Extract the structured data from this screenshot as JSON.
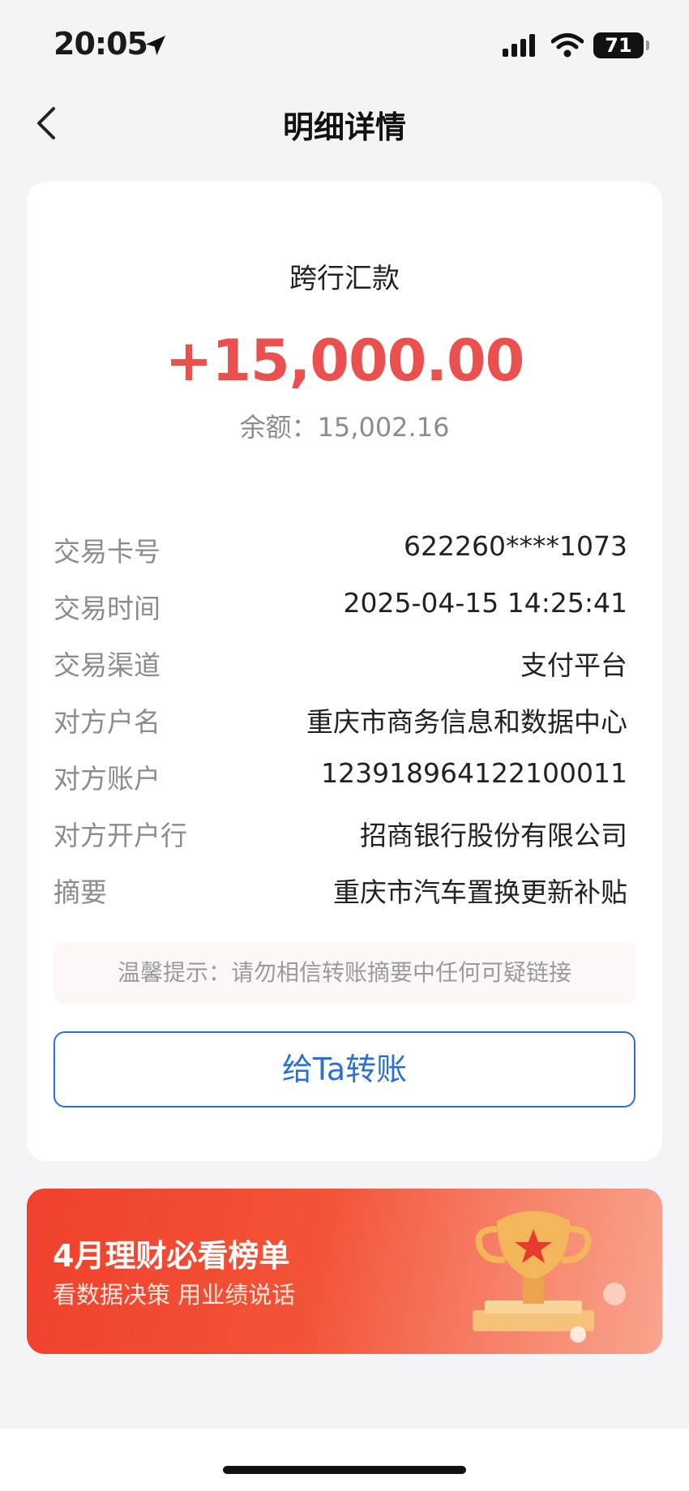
{
  "status_bar": {
    "time": "20:05",
    "battery": "71"
  },
  "nav": {
    "title": "明细详情"
  },
  "transaction": {
    "type": "跨行汇款",
    "amount": "+15,000.00",
    "balance": "余额：15,002.16"
  },
  "details": [
    {
      "label": "交易卡号",
      "value": "622260****1073"
    },
    {
      "label": "交易时间",
      "value": "2025-04-15 14:25:41"
    },
    {
      "label": "交易渠道",
      "value": "支付平台"
    },
    {
      "label": "对方户名",
      "value": "重庆市商务信息和数据中心"
    },
    {
      "label": "对方账户",
      "value": "123918964122100011"
    },
    {
      "label": "对方开户行",
      "value": "招商银行股份有限公司"
    },
    {
      "label": "摘要",
      "value": "重庆市汽车置换更新补贴"
    }
  ],
  "tip": "温馨提示：请勿相信转账摘要中任何可疑链接",
  "transfer_button": "给Ta转账",
  "banner": {
    "title": "4月理财必看榜单",
    "subtitle": "看数据决策 用业绩说话"
  },
  "colors": {
    "amount": "#e9504e",
    "accent": "#2a6fd1",
    "banner": "#f0412d"
  }
}
